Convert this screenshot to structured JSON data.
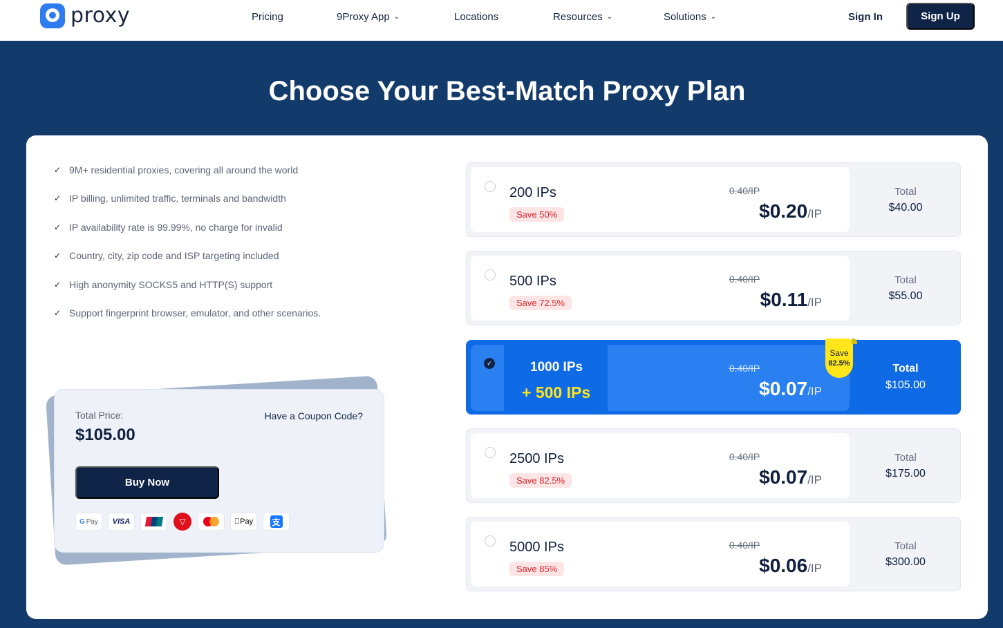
{
  "header": {
    "logo_text": "proxy",
    "nav": [
      {
        "label": "Pricing",
        "dropdown": false
      },
      {
        "label": "9Proxy App",
        "dropdown": true
      },
      {
        "label": "Locations",
        "dropdown": false
      },
      {
        "label": "Resources",
        "dropdown": true
      },
      {
        "label": "Solutions",
        "dropdown": true
      }
    ],
    "signin_label": "Sign In",
    "signup_label": "Sign Up"
  },
  "hero": {
    "title": "Choose Your Best-Match Proxy Plan"
  },
  "features": [
    "9M+ residential proxies, covering all around the world",
    "IP billing, unlimited traffic, terminals and bandwidth",
    "IP availability rate is 99.99%, no charge for invalid",
    "Country, city, zip code and ISP targeting included",
    "High anonymity SOCKS5 and HTTP(S) support",
    "Support fingerprint browser, emulator, and other scenarios."
  ],
  "summary": {
    "total_label": "Total Price:",
    "total_value": "$105.00",
    "coupon_label": "Have a Coupon Code?",
    "buy_label": "Buy Now",
    "payment_methods": [
      "Google Pay",
      "VISA",
      "UnionPay",
      "TRON",
      "Mastercard",
      "Apple Pay",
      "Alipay"
    ]
  },
  "plans": [
    {
      "ips": "200 IPs",
      "save": "Save 50%",
      "old_price": "0.40/IP",
      "price": "$0.20",
      "unit": "/IP",
      "total_label": "Total",
      "total": "$40.00",
      "selected": false
    },
    {
      "ips": "500 IPs",
      "save": "Save 72.5%",
      "old_price": "0.40/IP",
      "price": "$0.11",
      "unit": "/IP",
      "total_label": "Total",
      "total": "$55.00",
      "selected": false
    },
    {
      "ips": "1000 IPs",
      "bonus": "+ 500 IPs",
      "ribbon_save": "Save",
      "ribbon_pct": "82.5%",
      "old_price": "0.40/IP",
      "price": "$0.07",
      "unit": "/IP",
      "total_label": "Total",
      "total": "$105.00",
      "selected": true
    },
    {
      "ips": "2500 IPs",
      "save": "Save 82.5%",
      "old_price": "0.40/IP",
      "price": "$0.07",
      "unit": "/IP",
      "total_label": "Total",
      "total": "$175.00",
      "selected": false
    },
    {
      "ips": "5000 IPs",
      "save": "Save 85%",
      "old_price": "0.40/IP",
      "price": "$0.06",
      "unit": "/IP",
      "total_label": "Total",
      "total": "$300.00",
      "selected": false
    }
  ],
  "colors": {
    "navy": "#123a6b",
    "dark_button": "#0f2447",
    "selected_blue": "#0f6ae6",
    "accent_yellow": "#ffe61a",
    "save_red": "#e0262b"
  }
}
